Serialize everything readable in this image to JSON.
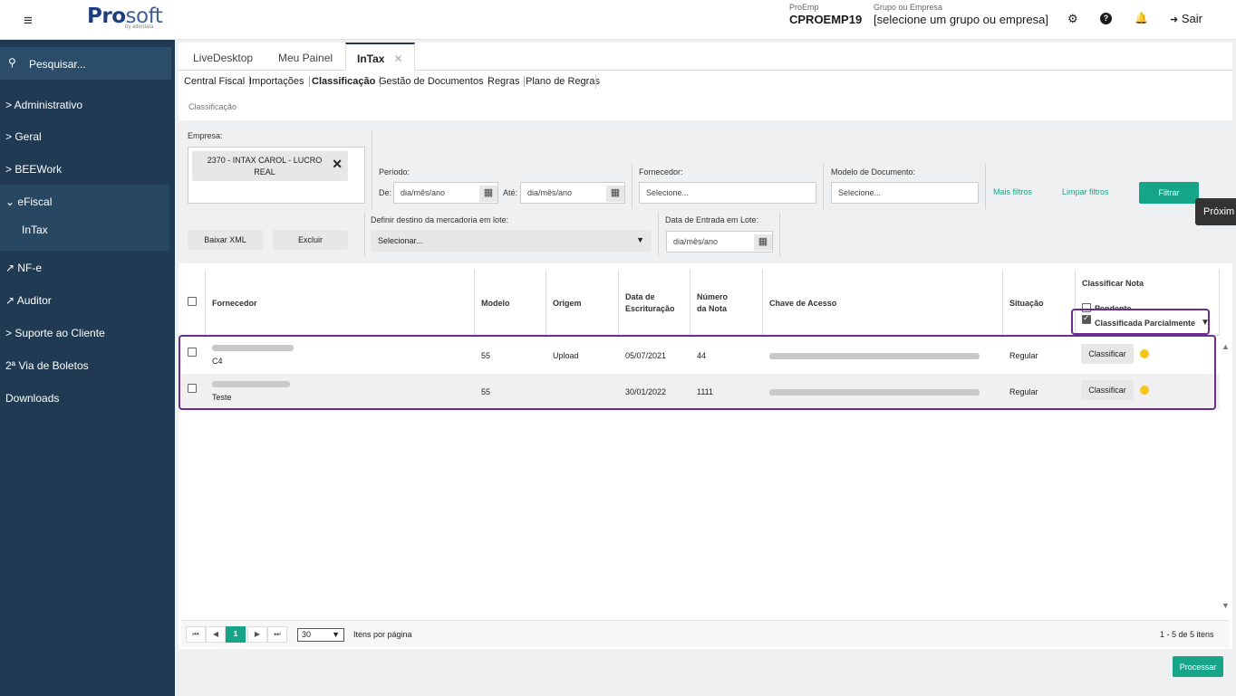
{
  "topbar": {
    "menu_icon": "≡",
    "logo_pro": "Pro",
    "logo_soft": "soft",
    "logo_sub": "by alterdata",
    "proemp_label": "ProEmp",
    "proemp_value": "CPROEMP19",
    "grupo_label": "Grupo ou Empresa",
    "grupo_value": "[selecione um grupo ou empresa]",
    "settings_icon": "⚙",
    "help_icon": "?",
    "bell_icon": "🔔",
    "sair_icon": "➜",
    "sair_label": "Sair"
  },
  "sidebar": {
    "search_icon": "🔍",
    "search_label": "Pesquisar...",
    "items": [
      {
        "label": "> Administrativo"
      },
      {
        "label": "> Geral"
      },
      {
        "label": "> BEEWork"
      },
      {
        "label": "⌄ eFiscal"
      },
      {
        "label": "InTax"
      },
      {
        "label": "↗ NF-e"
      },
      {
        "label": "↗ Auditor"
      },
      {
        "label": "> Suporte ao Cliente"
      },
      {
        "label": "2ª Via de Boletos"
      },
      {
        "label": "Downloads"
      }
    ]
  },
  "tabs": [
    {
      "label": "LiveDesktop"
    },
    {
      "label": "Meu Painel"
    },
    {
      "label": "InTax",
      "close": "✕"
    }
  ],
  "subnav": [
    "Central Fiscal",
    "Importações",
    "Classificação",
    "Gestão de Documentos",
    "Regras",
    "Plano de Regras"
  ],
  "breadcrumb": "Classificação",
  "filters": {
    "empresa_label": "Empresa:",
    "empresa_chip": "2370 - INTAX CAROL - LUCRO REAL",
    "chip_close": "✕",
    "periodo_label": "Período:",
    "de_label": "De:",
    "ate_label": "Até:",
    "date_placeholder": "dia/mês/ano",
    "calendar_icon": "▦",
    "fornecedor_label": "Fornecedor:",
    "fornecedor_placeholder": "Selecione...",
    "modelo_label": "Modelo de Documento:",
    "modelo_placeholder": "Selecione...",
    "mais_filtros": "Mais filtros",
    "limpar_filtros": "Limpar filtros",
    "filtrar": "Filtrar",
    "baixar_xml": "Baixar XML",
    "excluir": "Excluir",
    "destino_label": "Definir destino da mercadoria em lote:",
    "destino_value": "Selecionar...",
    "destino_arrow": "▼",
    "data_entrada_label": "Data de Entrada em Lote:",
    "tooltip": "Próxim"
  },
  "table": {
    "headers": {
      "fornecedor": "Fornecedor",
      "modelo": "Modelo",
      "origem": "Origem",
      "data_escrituracao_1": "Data de",
      "data_escrituracao_2": "Escrituração",
      "numero_1": "Número",
      "numero_2": "da Nota",
      "chave": "Chave de Acesso",
      "situacao": "Situação",
      "classificar_nota": "Classificar Nota",
      "opt_pendente": "Pendente",
      "opt_parcial": "Classificada Parcialmente",
      "filter_icon": "▼"
    },
    "rows": [
      {
        "fornecedor_sub": "C4",
        "modelo": "55",
        "origem": "Upload",
        "data": "05/07/2021",
        "numero": "44",
        "situacao": "Regular",
        "action": "Classificar",
        "status_color": "#f5c518"
      },
      {
        "fornecedor_sub": "Teste",
        "modelo": "55",
        "origem": "",
        "data": "30/01/2022",
        "numero": "1111",
        "situacao": "Regular",
        "action": "Classificar",
        "status_color": "#f5c518"
      }
    ],
    "scroll_up": "▲",
    "scroll_down": "▼"
  },
  "pager": {
    "first": "⏮",
    "prev": "◀",
    "page": "1",
    "next": "▶",
    "last": "⏭",
    "per_page": "30",
    "per_page_arrow": "▼",
    "per_page_label": "Itens por página",
    "summary": "1 - 5 de 5 itens"
  },
  "processar": "Processar",
  "colors": {
    "accent": "#17a589",
    "sidebar": "#1f3a52",
    "highlight": "#6b2d8f",
    "status_dot": "#f5c518"
  }
}
